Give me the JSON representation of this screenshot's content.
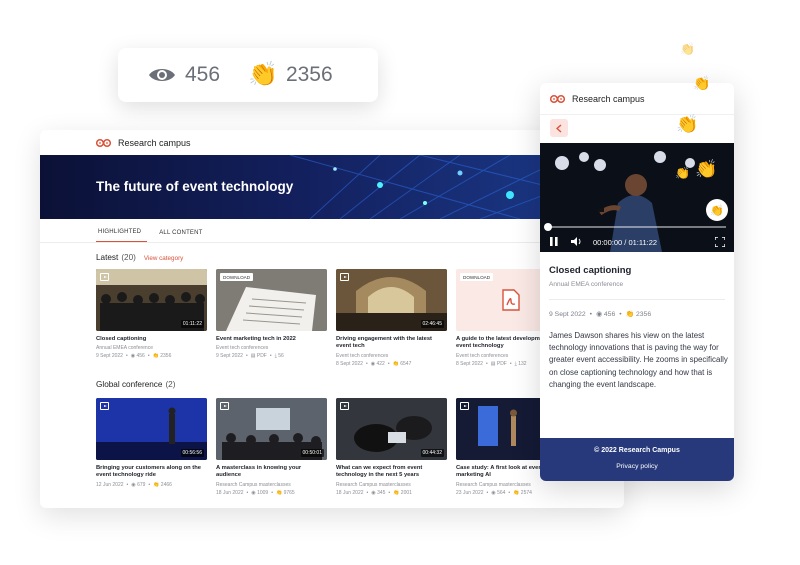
{
  "stats_card": {
    "views": "456",
    "claps": "2356"
  },
  "desktop": {
    "brand": "Research campus",
    "hero_title": "The future of event technology",
    "tabs": [
      {
        "label": "HIGHLIGHTED",
        "active": true
      },
      {
        "label": "ALL CONTENT",
        "active": false
      }
    ],
    "latest": {
      "title": "Latest",
      "count": "(20)",
      "link": "View category",
      "items": [
        {
          "title": "Closed captioning",
          "subtitle": "Annual EMEA conference",
          "date": "9 Sept 2022",
          "views": "456",
          "claps": "2356",
          "duration": "01:11:22",
          "kind": "video"
        },
        {
          "title": "Event marketing tech in 2022",
          "subtitle": "Event tech conferences",
          "date": "9 Sept 2022",
          "format": "PDF",
          "downloads": "56",
          "badge": "DOWNLOAD",
          "kind": "download"
        },
        {
          "title": "Driving engagement with the latest event tech",
          "subtitle": "Event tech conferences",
          "date": "8 Sept 2022",
          "views": "422",
          "claps": "6547",
          "duration": "02:46:45",
          "kind": "video"
        },
        {
          "title": "A guide to the latest development in event technology",
          "subtitle": "Event tech conferences",
          "date": "8 Sept 2022",
          "format": "PDF",
          "downloads": "132",
          "badge": "DOWNLOAD",
          "kind": "download"
        }
      ]
    },
    "global": {
      "title": "Global conference",
      "count": "(2)",
      "items": [
        {
          "title": "Bringing your customers along on the event technology ride",
          "subtitle": "",
          "date": "12 Jun 2022",
          "views": "679",
          "claps": "2466",
          "duration": "00:56:56",
          "kind": "video"
        },
        {
          "title": "A masterclass in knowing your audience",
          "subtitle": "Research Campus masterclasses",
          "date": "18 Jun 2022",
          "views": "1009",
          "claps": "9765",
          "duration": "00:50:01",
          "kind": "video"
        },
        {
          "title": "What can we expect from event technology in the next 5 years",
          "subtitle": "Research Campus masterclasses",
          "date": "18 Jun 2022",
          "views": "345",
          "claps": "2001",
          "duration": "00:44:32",
          "kind": "video"
        },
        {
          "title": "Case study: A first look at event marketing AI",
          "subtitle": "Research Campus masterclasses",
          "date": "23 Jun 2022",
          "views": "564",
          "claps": "2574",
          "duration": "",
          "kind": "video"
        }
      ]
    }
  },
  "mobile": {
    "brand": "Research campus",
    "player_time": "00:00:00 / 01:11:22",
    "title": "Closed captioning",
    "subtitle": "Annual EMEA conference",
    "date": "9 Sept 2022",
    "views": "456",
    "claps": "2356",
    "description": "James Dawson shares his view on the latest technology innovations that is paving the way for greater event accessibility. He zooms in specifically on close captioning technology and how that is changing the event landscape.",
    "footer_copyright": "© 2022 Research Campus",
    "footer_link": "Privacy policy"
  },
  "colors": {
    "accent": "#d9533b",
    "footer": "#27397a",
    "hero": "#13205e"
  }
}
